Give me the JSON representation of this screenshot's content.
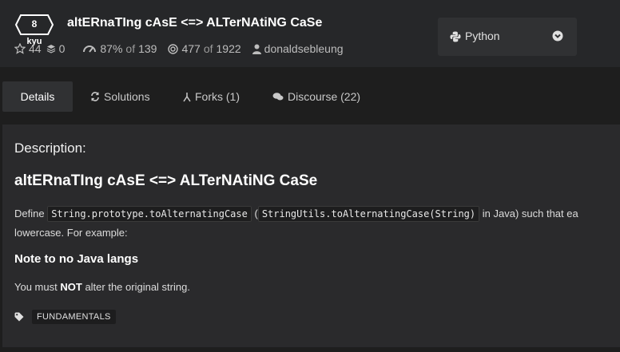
{
  "kata": {
    "rank_number": "8",
    "rank_unit": "kyu",
    "title": "altERnaTIng cAsE <=> ALTerNAtiNG CaSe"
  },
  "stats": {
    "stars": "44",
    "collections": "0",
    "satisfaction": "87%",
    "satisfaction_of": "of",
    "satisfaction_votes": "139",
    "completed": "477",
    "completed_of": "of",
    "completed_total": "1922",
    "author": "donaldsebleung"
  },
  "language": {
    "selected": "Python",
    "icon": "python-icon"
  },
  "tabs": [
    {
      "label": "Details",
      "icon": "none",
      "active": true
    },
    {
      "label": "Solutions",
      "icon": "solutions-icon"
    },
    {
      "label": "Forks (1)",
      "icon": "fork-icon"
    },
    {
      "label": "Discourse (22)",
      "icon": "discourse-icon"
    }
  ],
  "description": {
    "heading": "Description:",
    "title": "altERnaTIng cAsE <=> ALTerNAtiNG CaSe",
    "define": "Define",
    "code1": "String.prototype.toAlternatingCase",
    "paren_open": "(",
    "code2": "StringUtils.toAlternatingCase(String)",
    "after_code2": "in Java) such that ea",
    "line2": "lowercase. For example:",
    "note_heading": "Note to no Java langs",
    "note_prefix": "You must",
    "note_strong": "NOT",
    "note_suffix": "alter the original string.",
    "tags": [
      "FUNDAMENTALS"
    ]
  },
  "colors": {
    "background": "#1e1e1e",
    "header": "#262729",
    "panel": "#2a2a2c",
    "text": "#ffffff"
  }
}
